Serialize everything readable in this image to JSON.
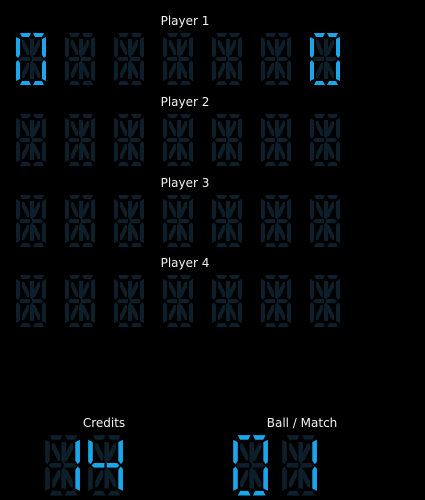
{
  "colors": {
    "background": "#000000",
    "segment_lit": "#1aa6ea",
    "segment_unlit": "#0c1f2b",
    "label": "#f2f2f2"
  },
  "players": [
    {
      "label": "Player 1",
      "digits": [
        "0",
        "",
        "",
        "",
        "",
        "",
        "0"
      ]
    },
    {
      "label": "Player 2",
      "digits": [
        "",
        "",
        "",
        "",
        "",
        "",
        ""
      ]
    },
    {
      "label": "Player 3",
      "digits": [
        "",
        "",
        "",
        "",
        "",
        "",
        ""
      ]
    },
    {
      "label": "Player 4",
      "digits": [
        "",
        "",
        "",
        "",
        "",
        "",
        ""
      ]
    }
  ],
  "credits": {
    "label": "Credits",
    "digits": [
      "1",
      "4"
    ]
  },
  "ball_match": {
    "label": "Ball / Match",
    "digits": [
      "0",
      "1"
    ]
  }
}
